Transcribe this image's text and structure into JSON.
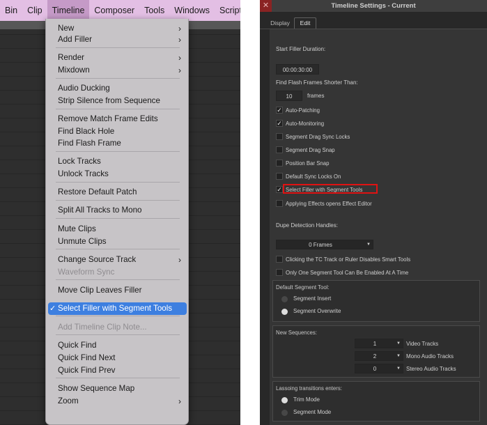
{
  "menubar": {
    "items": [
      "Bin",
      "Clip",
      "Timeline",
      "Composer",
      "Tools",
      "Windows",
      "Script"
    ]
  },
  "menu": {
    "items": [
      {
        "label": "New",
        "submenu": true
      },
      {
        "label": "Add Filler",
        "submenu": true
      },
      {
        "label": "Render",
        "submenu": true
      },
      {
        "label": "Mixdown",
        "submenu": true
      },
      {
        "label": "Audio Ducking"
      },
      {
        "label": "Strip Silence from Sequence"
      },
      {
        "label": "Remove Match Frame Edits"
      },
      {
        "label": "Find Black Hole"
      },
      {
        "label": "Find Flash Frame"
      },
      {
        "label": "Lock Tracks"
      },
      {
        "label": "Unlock Tracks"
      },
      {
        "label": "Restore Default Patch"
      },
      {
        "label": "Split All Tracks to Mono"
      },
      {
        "label": "Mute Clips"
      },
      {
        "label": "Unmute Clips"
      },
      {
        "label": "Change Source Track",
        "submenu": true
      },
      {
        "label": "Waveform Sync",
        "disabled": true
      },
      {
        "label": "Move Clip Leaves Filler"
      },
      {
        "label": "Select Filler with Segment Tools",
        "checked": true,
        "selected": true
      },
      {
        "label": "Add Timeline Clip Note...",
        "disabled": true
      },
      {
        "label": "Quick Find"
      },
      {
        "label": "Quick Find Next"
      },
      {
        "label": "Quick Find Prev"
      },
      {
        "label": "Show Sequence Map"
      },
      {
        "label": "Zoom",
        "submenu": true
      }
    ]
  },
  "dialog": {
    "title": "Timeline Settings - Current",
    "close_glyph": "✕",
    "tabs": [
      {
        "label": "Display"
      },
      {
        "label": "Edit",
        "active": true
      }
    ],
    "start_filler_label": "Start Filler Duration:",
    "start_filler_value": "00:00:30:00",
    "flash_frames_label": "Find Flash Frames Shorter Than:",
    "flash_frames_value": "10",
    "flash_frames_units": "frames",
    "checkboxes_a": [
      {
        "label": "Auto-Patching",
        "checked": true
      },
      {
        "label": "Auto-Monitoring",
        "checked": true
      },
      {
        "label": "Segment Drag Sync Locks",
        "checked": false
      },
      {
        "label": "Segment Drag Snap",
        "checked": false
      },
      {
        "label": "Position Bar Snap",
        "checked": false
      },
      {
        "label": "Default Sync Locks On",
        "checked": false
      },
      {
        "label": "Select Filler with Segment Tools",
        "checked": true
      },
      {
        "label": "Applying Effects opens Effect Editor",
        "checked": false
      }
    ],
    "dupe_label": "Dupe Detection Handles:",
    "dupe_value": "0 Frames",
    "checkboxes_b": [
      {
        "label": "Clicking the TC Track or Ruler Disables Smart Tools",
        "checked": false
      },
      {
        "label": "Only One Segment Tool Can Be Enabled At A Time",
        "checked": false
      }
    ],
    "segment_tool_group": {
      "label": "Default Segment Tool:",
      "options": [
        {
          "label": "Segment Insert",
          "selected": false
        },
        {
          "label": "Segment Overwrite",
          "selected": true
        }
      ]
    },
    "new_sequences_group": {
      "label": "New Sequences:",
      "rows": [
        {
          "value": "1",
          "label": "Video Tracks"
        },
        {
          "value": "2",
          "label": "Mono Audio Tracks"
        },
        {
          "value": "0",
          "label": "Stereo Audio Tracks"
        }
      ]
    },
    "lasso_group": {
      "label": "Lassoing transitions enters:",
      "options": [
        {
          "label": "Trim Mode",
          "selected": true
        },
        {
          "label": "Segment Mode",
          "selected": false
        }
      ]
    },
    "highlight_color": "#e01212"
  }
}
